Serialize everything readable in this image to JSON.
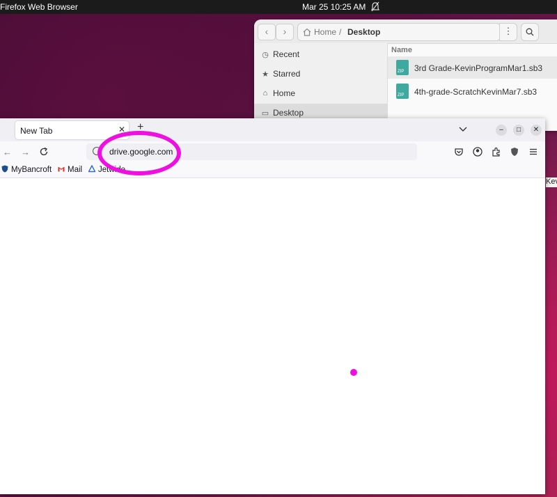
{
  "topbar": {
    "app_name": "Firefox Web Browser",
    "datetime": "Mar 25  10:25 AM",
    "icons": [
      "notifications-off-icon"
    ]
  },
  "files_window": {
    "path": [
      "Home",
      "Desktop"
    ],
    "sidebar": [
      {
        "label": "Recent",
        "icon": "clock-icon"
      },
      {
        "label": "Starred",
        "icon": "star-icon"
      },
      {
        "label": "Home",
        "icon": "home-icon"
      },
      {
        "label": "Desktop",
        "icon": "desktop-icon",
        "active": true
      }
    ],
    "column_header": "Name",
    "files": [
      {
        "name": "3rd Grade-KevinProgramMar1.sb3",
        "icon": "zip-file-icon",
        "selected": true
      },
      {
        "name": "4th-grade-ScratchKevinMar7.sb3",
        "icon": "zip-file-icon"
      }
    ],
    "zip_label": "ZIP"
  },
  "browser": {
    "tab_title": "New Tab",
    "url": "drive.google.com",
    "bookmarks": [
      {
        "label": "MyBancroft",
        "icon": "shield-icon"
      },
      {
        "label": "Mail",
        "icon": "gmail-icon"
      },
      {
        "label": "Jetwide",
        "icon": "triangle-icon"
      }
    ],
    "edge_text": "Kev"
  },
  "colors": {
    "annotation": "#ee10e0",
    "zip_icon": "#3fa9a0"
  }
}
